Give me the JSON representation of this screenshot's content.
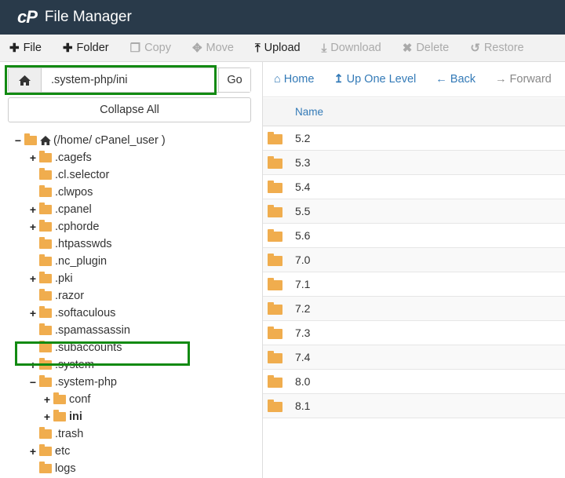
{
  "header": {
    "logo": "cP",
    "title": "File Manager"
  },
  "toolbar": [
    {
      "icon": "plus-icon",
      "glyph": "✚",
      "label": "File",
      "enabled": true
    },
    {
      "icon": "plus-icon",
      "glyph": "✚",
      "label": "Folder",
      "enabled": true
    },
    {
      "icon": "copy-icon",
      "glyph": "❐",
      "label": "Copy",
      "enabled": false
    },
    {
      "icon": "move-icon",
      "glyph": "✥",
      "label": "Move",
      "enabled": false
    },
    {
      "icon": "upload-icon",
      "glyph": "⤒",
      "label": "Upload",
      "enabled": true
    },
    {
      "icon": "download-icon",
      "glyph": "⤓",
      "label": "Download",
      "enabled": false
    },
    {
      "icon": "delete-icon",
      "glyph": "✖",
      "label": "Delete",
      "enabled": false
    },
    {
      "icon": "restore-icon",
      "glyph": "↺",
      "label": "Restore",
      "enabled": false
    }
  ],
  "left": {
    "path_value": ".system-php/ini",
    "go_label": "Go",
    "collapse_label": "Collapse All"
  },
  "tree": [
    {
      "toggle": "−",
      "icon": "home-icon",
      "label": "(/home/ cPanel_user )",
      "level": 0,
      "root": true
    },
    {
      "toggle": "+",
      "label": ".cagefs",
      "level": 1
    },
    {
      "toggle": "",
      "label": ".cl.selector",
      "level": 1
    },
    {
      "toggle": "",
      "label": ".clwpos",
      "level": 1
    },
    {
      "toggle": "+",
      "label": ".cpanel",
      "level": 1
    },
    {
      "toggle": "+",
      "label": ".cphorde",
      "level": 1
    },
    {
      "toggle": "",
      "label": ".htpasswds",
      "level": 1
    },
    {
      "toggle": "",
      "label": ".nc_plugin",
      "level": 1
    },
    {
      "toggle": "+",
      "label": ".pki",
      "level": 1
    },
    {
      "toggle": "",
      "label": ".razor",
      "level": 1
    },
    {
      "toggle": "+",
      "label": ".softaculous",
      "level": 1
    },
    {
      "toggle": "",
      "label": ".spamassassin",
      "level": 1
    },
    {
      "toggle": "",
      "label": ".subaccounts",
      "level": 1
    },
    {
      "toggle": "+",
      "label": ".system",
      "level": 1
    },
    {
      "toggle": "−",
      "label": ".system-php",
      "level": 1
    },
    {
      "toggle": "+",
      "label": "conf",
      "level": 2
    },
    {
      "toggle": "+",
      "label": "ini",
      "level": 2,
      "selected": true
    },
    {
      "toggle": "",
      "label": ".trash",
      "level": 1
    },
    {
      "toggle": "+",
      "label": "etc",
      "level": 1
    },
    {
      "toggle": "",
      "label": "logs",
      "level": 1
    }
  ],
  "nav": [
    {
      "icon": "home-icon",
      "glyph": "⌂",
      "label": "Home",
      "enabled": true
    },
    {
      "icon": "up-arrow-icon",
      "glyph": "↥",
      "label": "Up One Level",
      "enabled": true
    },
    {
      "icon": "back-arrow-icon",
      "glyph": "←",
      "label": "Back",
      "enabled": true
    },
    {
      "icon": "forward-arrow-icon",
      "glyph": "→",
      "label": "Forward",
      "enabled": false
    }
  ],
  "listing": {
    "column_name": "Name",
    "items": [
      "5.2",
      "5.3",
      "5.4",
      "5.5",
      "5.6",
      "7.0",
      "7.1",
      "7.2",
      "7.3",
      "7.4",
      "8.0",
      "8.1"
    ]
  },
  "colors": {
    "header_bg": "#293a4a",
    "folder": "#f0ad4e",
    "link": "#337ab7",
    "highlight": "#128a12"
  }
}
